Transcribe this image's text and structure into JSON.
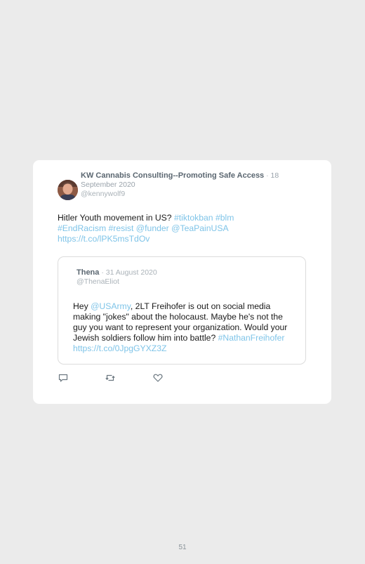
{
  "tweet": {
    "author_name": "KW Cannabis Consulting--Promoting Safe Access",
    "separator": "·",
    "date": "18 September 2020",
    "handle": "@kennywolf9",
    "text_parts": [
      {
        "text": "Hitler Youth movement in US? ",
        "link": false
      },
      {
        "text": "#tiktokban",
        "link": true
      },
      {
        "text": " ",
        "link": false
      },
      {
        "text": "#blm",
        "link": true
      },
      {
        "text": " ",
        "link": false
      },
      {
        "text": "#EndRacism",
        "link": true
      },
      {
        "text": " ",
        "link": false
      },
      {
        "text": "#resist",
        "link": true
      },
      {
        "text": " ",
        "link": false
      },
      {
        "text": "@funder",
        "link": true
      },
      {
        "text": " ",
        "link": false
      },
      {
        "text": "@TeaPainUSA",
        "link": true
      },
      {
        "text": " ",
        "link": false
      },
      {
        "text": "https://t.co/lPK5msTdOv",
        "link": true
      }
    ]
  },
  "quoted_tweet": {
    "author_name": "Thena",
    "separator": "·",
    "date": "31 August 2020",
    "handle": "@ThenaEliot",
    "text_parts": [
      {
        "text": "Hey ",
        "link": false
      },
      {
        "text": "@USArmy",
        "link": true
      },
      {
        "text": ", 2LT Freihofer is out on social media making \"jokes\" about the holocaust. Maybe he's not the guy you want to represent your organization. Would your Jewish soldiers follow him into battle? ",
        "link": false
      },
      {
        "text": "#NathanFreihofer",
        "link": true
      },
      {
        "text": " ",
        "link": false
      },
      {
        "text": "https://t.co/0JpgGYXZ3Z",
        "link": true
      }
    ]
  },
  "actions": {
    "icons": [
      "reply-icon",
      "retweet-icon",
      "like-icon"
    ]
  },
  "colors": {
    "background": "#ebebeb",
    "card": "#ffffff",
    "link": "#7fc4e8"
  },
  "footer": {
    "page_number": "51"
  }
}
